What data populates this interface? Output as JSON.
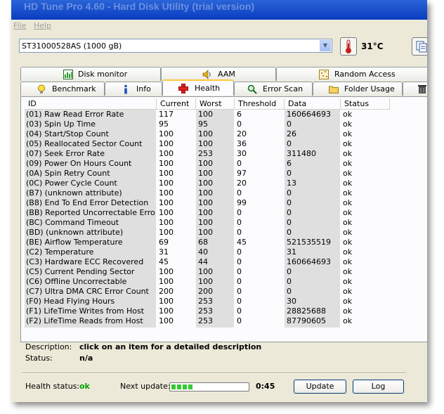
{
  "window": {
    "title": "HD Tune Pro 4.60 - Hard Disk Utility (trial version)"
  },
  "menu": {
    "file": "File",
    "help": "Help"
  },
  "drive": {
    "selected": "ST31000528AS (1000 gB)"
  },
  "temperature": "31°C",
  "tabs_top": [
    "Disk monitor",
    "AAM",
    "Random Access"
  ],
  "tabs_bottom": [
    "Benchmark",
    "Info",
    "Health",
    "Error Scan",
    "Folder Usage"
  ],
  "active_tab": "Health",
  "table": {
    "columns": [
      "ID",
      "Current",
      "Worst",
      "Threshold",
      "Data",
      "Status"
    ],
    "rows": [
      [
        "(01) Raw Read Error Rate",
        "117",
        "100",
        "6",
        "160664693",
        "ok"
      ],
      [
        "(03) Spin Up Time",
        "95",
        "95",
        "0",
        "0",
        "ok"
      ],
      [
        "(04) Start/Stop Count",
        "100",
        "100",
        "20",
        "26",
        "ok"
      ],
      [
        "(05) Reallocated Sector Count",
        "100",
        "100",
        "36",
        "0",
        "ok"
      ],
      [
        "(07) Seek Error Rate",
        "100",
        "253",
        "30",
        "311480",
        "ok"
      ],
      [
        "(09) Power On Hours Count",
        "100",
        "100",
        "0",
        "6",
        "ok"
      ],
      [
        "(0A) Spin Retry Count",
        "100",
        "100",
        "97",
        "0",
        "ok"
      ],
      [
        "(0C) Power Cycle Count",
        "100",
        "100",
        "20",
        "13",
        "ok"
      ],
      [
        "(B7) (unknown attribute)",
        "100",
        "100",
        "0",
        "0",
        "ok"
      ],
      [
        "(B8) End To End Error Detection",
        "100",
        "100",
        "99",
        "0",
        "ok"
      ],
      [
        "(BB) Reported Uncorrectable Errors",
        "100",
        "100",
        "0",
        "0",
        "ok"
      ],
      [
        "(BC) Command Timeout",
        "100",
        "100",
        "0",
        "0",
        "ok"
      ],
      [
        "(BD) (unknown attribute)",
        "100",
        "100",
        "0",
        "0",
        "ok"
      ],
      [
        "(BE) Airflow Temperature",
        "69",
        "68",
        "45",
        "521535519",
        "ok"
      ],
      [
        "(C2) Temperature",
        "31",
        "40",
        "0",
        "31",
        "ok"
      ],
      [
        "(C3) Hardware ECC Recovered",
        "45",
        "44",
        "0",
        "160664693",
        "ok"
      ],
      [
        "(C5) Current Pending Sector",
        "100",
        "100",
        "0",
        "0",
        "ok"
      ],
      [
        "(C6) Offline Uncorrectable",
        "100",
        "100",
        "0",
        "0",
        "ok"
      ],
      [
        "(C7) Ultra DMA CRC Error Count",
        "200",
        "200",
        "0",
        "0",
        "ok"
      ],
      [
        "(F0) Head Flying Hours",
        "100",
        "253",
        "0",
        "30",
        "ok"
      ],
      [
        "(F1) LifeTime Writes from Host",
        "100",
        "253",
        "0",
        "28825688",
        "ok"
      ],
      [
        "(F2) LifeTime Reads from Host",
        "100",
        "253",
        "0",
        "87790605",
        "ok"
      ]
    ]
  },
  "description": {
    "label": "Description:",
    "value": "click on an item for a detailed description"
  },
  "status": {
    "label": "Status:",
    "value": "n/a"
  },
  "footer": {
    "health_label": "Health status:",
    "health_value": "ok",
    "health_color": "#00a000",
    "next_update_label": "Next update:",
    "next_update_progress": 0.3,
    "timer": "0:45",
    "update_button": "Update",
    "log_button": "Log"
  }
}
